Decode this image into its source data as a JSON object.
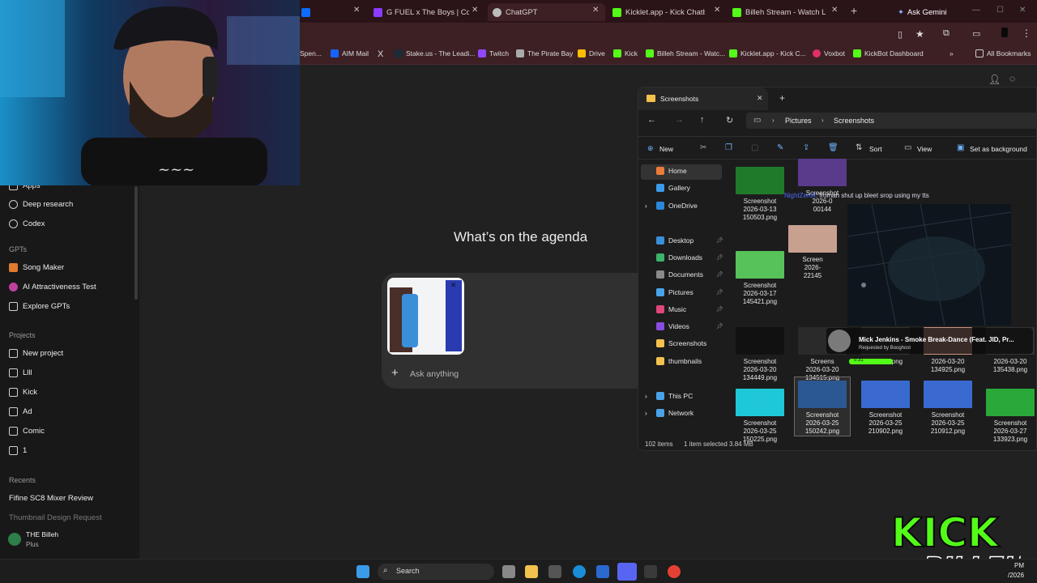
{
  "browser": {
    "tabs": [
      {
        "label": "Spen...",
        "fav": "#0b6cff"
      },
      {
        "label": "G FUEL x The Boys | Compo",
        "fav": "#8a3cff"
      },
      {
        "label": "ChatGPT",
        "fav": "#bbbbbb"
      },
      {
        "label": "Kicklet.app - Kick Chatbot a",
        "fav": "#53fc18"
      },
      {
        "label": "Billeh Stream - Watch Live o",
        "fav": "#53fc18"
      }
    ],
    "new_tab": "+",
    "ask_gemini": "Ask Gemini",
    "bookmarks": [
      {
        "label": "Spen...",
        "fav": "#0b6cff"
      },
      {
        "label": "AIM Mail",
        "fav": "#1763ff"
      },
      {
        "label": "X",
        "fav": "#000000"
      },
      {
        "label": "Stake.us - The Leadi...",
        "fav": "#1a2c38"
      },
      {
        "label": "Twitch",
        "fav": "#9146ff"
      },
      {
        "label": "The Pirate Bay",
        "fav": "#aaaaaa"
      },
      {
        "label": "Drive",
        "fav": "#fbbc04"
      },
      {
        "label": "Kick",
        "fav": "#53fc18"
      },
      {
        "label": "Billeh Stream - Watc...",
        "fav": "#53fc18"
      },
      {
        "label": "Kicklet.app - Kick C...",
        "fav": "#53fc18"
      },
      {
        "label": "Voxbot",
        "fav": "#e0306a"
      },
      {
        "label": "KickBot Dashboard",
        "fav": "#53fc18"
      }
    ],
    "all_bookmarks": "All Bookmarks"
  },
  "sidebar": {
    "items_top": [
      "Apps",
      "Deep research",
      "Codex"
    ],
    "gpts_heading": "GPTs",
    "gpts": [
      "Song Maker",
      "AI Attractiveness Test",
      "Explore GPTs"
    ],
    "projects_heading": "Projects",
    "projects": [
      "New project",
      "Llll",
      "Kick",
      "Ad",
      "Comic",
      "1"
    ],
    "recents_heading": "Recents",
    "recents": [
      "Fifine SC8 Mixer Review",
      "Thumbnail Design Request"
    ],
    "user_name": "THE Billeh",
    "user_plan": "Plus"
  },
  "chat": {
    "headline": "What’s on the agenda",
    "composer_placeholder": "Ask anything",
    "add_button": "+"
  },
  "explorer": {
    "title": "Screenshots",
    "breadcrumb": [
      "Pictures",
      "Screenshots"
    ],
    "toolbar": {
      "new": "New",
      "sort": "Sort",
      "view": "View",
      "set_bg": "Set as background"
    },
    "nav": [
      {
        "label": "Home",
        "color": "#e97c36"
      },
      {
        "label": "Gallery",
        "color": "#3b9be8"
      },
      {
        "label": "OneDrive",
        "color": "#2b88d8"
      },
      {
        "label": "Desktop",
        "color": "#3a8fd9"
      },
      {
        "label": "Downloads",
        "color": "#3bb36b"
      },
      {
        "label": "Documents",
        "color": "#8a8a8a"
      },
      {
        "label": "Pictures",
        "color": "#4aa3e8"
      },
      {
        "label": "Music",
        "color": "#e0467a"
      },
      {
        "label": "Videos",
        "color": "#8a4ce0"
      },
      {
        "label": "Screenshots",
        "color": "#f2c14e"
      },
      {
        "label": "thumbnails",
        "color": "#f2c14e"
      },
      {
        "label": "This PC",
        "color": "#4aa3e8"
      },
      {
        "label": "Network",
        "color": "#4aa3e8"
      }
    ],
    "files": [
      {
        "name": "Screenshot",
        "date": "2026-03-13",
        "id": "150503.png",
        "color": "#1f7a2a"
      },
      {
        "name": "Screenshot",
        "date": "2026-0",
        "id": "00144",
        "color": "#5a3a8a"
      },
      {
        "name": "Screenshot",
        "date": "2026-03-17",
        "id": "145421.png",
        "color": "#58c25a"
      },
      {
        "name": "Screen",
        "date": "2026-",
        "id": "22145",
        "color": "#c8a090"
      },
      {
        "name": "Screenshot",
        "date": "2026-03-20",
        "id": "134449.png",
        "color": "#111111"
      },
      {
        "name": "Screens",
        "date": "2026-03-20",
        "id": "134515.png",
        "color": "#2a2a2a"
      },
      {
        "name": "",
        "date": "",
        "id": "134750.png",
        "color": "#333333"
      },
      {
        "name": "",
        "date": "2026-03-20",
        "id": "134925.png",
        "color": "#c89080"
      },
      {
        "name": "",
        "date": "2026-03-20",
        "id": "135438.png",
        "color": "#333333"
      },
      {
        "name": "Screenshot",
        "date": "2026-03-25",
        "id": "150225.png",
        "color": "#1fc8d8"
      },
      {
        "name": "Screenshot",
        "date": "2026-03-25",
        "id": "150242.png",
        "color": "#1a4a8a"
      },
      {
        "name": "Screenshot",
        "date": "2026-03-25",
        "id": "210902.png",
        "color": "#3a6ad0"
      },
      {
        "name": "Screenshot",
        "date": "2026-03-25",
        "id": "210912.png",
        "color": "#3a6ad0"
      },
      {
        "name": "Screenshot",
        "date": "2026-03-27",
        "id": "133923.png",
        "color": "#2aa83a"
      }
    ],
    "status_count": "102 items",
    "status_selected": "1 item selected 3.84 MB"
  },
  "overlay": {
    "chat_line": ": froman shut up bleet srop using my tts",
    "chat_user": "NightZeroll",
    "song": "Mick Jenkins - Smoke Break-Dance (Feat. JID, Pr...",
    "requested": "Requested by Booghost",
    "time": "0:31"
  },
  "taskbar": {
    "search": "Search",
    "clock_time": "PM",
    "clock_date": "/2026"
  },
  "branding": {
    "line1": "KICK",
    "line2": "BILLEH"
  }
}
